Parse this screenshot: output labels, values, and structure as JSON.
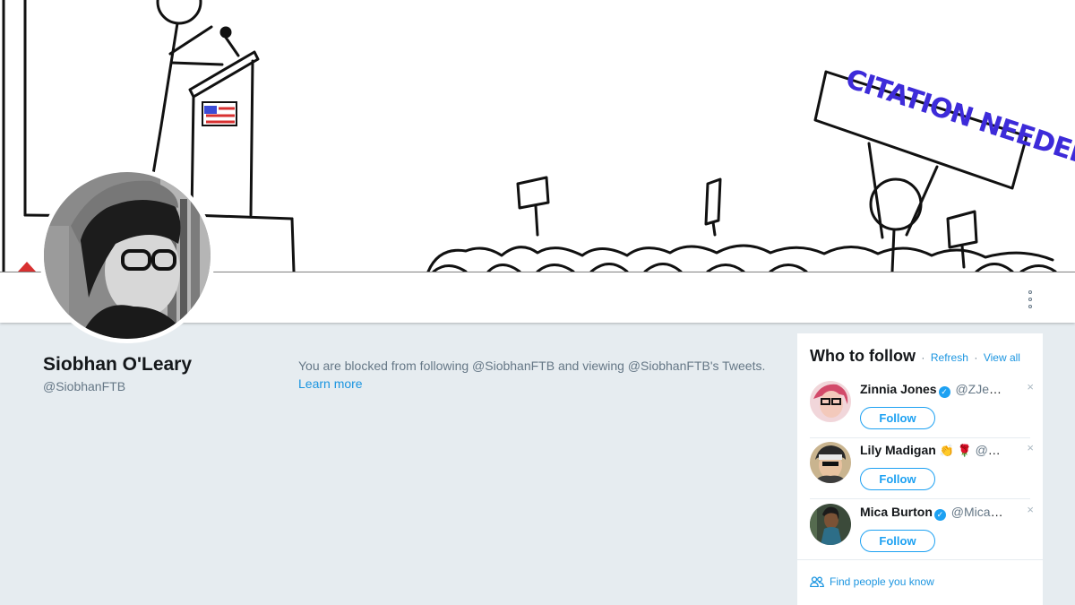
{
  "banner": {
    "sign_text": "CITATION NEEDED"
  },
  "profile": {
    "name": "Siobhan O'Leary",
    "handle": "@SiobhanFTB",
    "blocked_text": "You are blocked from following @SiobhanFTB and viewing @SiobhanFTB's Tweets.",
    "learn_more": "Learn more"
  },
  "who_to_follow": {
    "title": "Who to follow",
    "separator": "·",
    "refresh": "Refresh",
    "view_all": "View all",
    "accounts": [
      {
        "name": "Zinnia Jones",
        "verified": true,
        "emoji": "",
        "handle": "@ZJemptv",
        "follow_label": "Follow",
        "dismiss": "×"
      },
      {
        "name": "Lily Madigan",
        "verified": false,
        "emoji": "👏 🌹",
        "handle": "@ma…",
        "follow_label": "Follow",
        "dismiss": "×"
      },
      {
        "name": "Mica Burton",
        "verified": true,
        "emoji": "",
        "handle": "@MicaBu…",
        "follow_label": "Follow",
        "dismiss": "×"
      }
    ],
    "find_people": "Find people you know"
  },
  "colors": {
    "page_bg": "#e6ecf0",
    "link": "#1b95e0",
    "brand": "#1da1f2",
    "text_primary": "#14171a",
    "text_secondary": "#657786",
    "sign_ink": "#3d2bd9"
  },
  "icons": {
    "more": "more-vertical-icon",
    "verified": "verified-badge-icon",
    "people": "people-icon",
    "close": "close-icon"
  }
}
